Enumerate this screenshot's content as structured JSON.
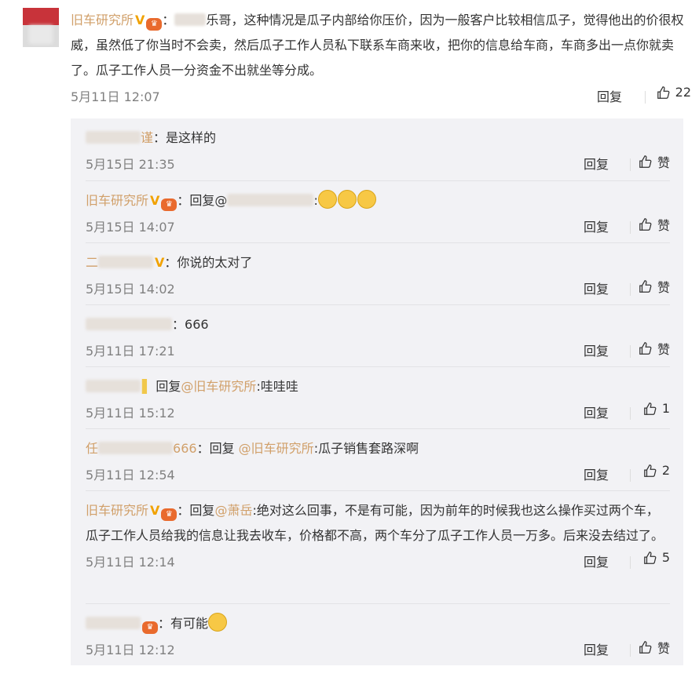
{
  "main_comment": {
    "author": "旧车研究所",
    "reply_to_suffix": "乐哥",
    "text": "，这种情况是瓜子内部给你压价，因为一般客户比较相信瓜子，觉得他出的价很权威，虽然低了你当时不会卖，然后瓜子工作人员私下联系车商来收，把你的信息给车商，车商多出一点你就卖了。瓜子工作人员一分资金不出就坐等分成。",
    "time": "5月11日 12:07",
    "reply_label": "回复",
    "likes": "22"
  },
  "replies": [
    {
      "author": "",
      "author_suffix": "谨",
      "text": "是这样的",
      "time": "5月15日 21:35",
      "reply_label": "回复",
      "likes": "赞"
    },
    {
      "author": "旧车研究所",
      "text": "回复@",
      "mention_suffix": "",
      "emoji_count": 3,
      "time": "5月15日 14:07",
      "reply_label": "回复",
      "likes": "赞"
    },
    {
      "author": "二",
      "text": "你说的太对了",
      "time": "5月15日 14:02",
      "reply_label": "回复",
      "likes": "赞"
    },
    {
      "author": "",
      "text": "666",
      "time": "5月11日 17:21",
      "reply_label": "回复",
      "likes": "赞"
    },
    {
      "author": "",
      "text": "回复",
      "mention": "@旧车研究所",
      "tail": ":哇哇哇",
      "time": "5月11日 15:12",
      "reply_label": "回复",
      "likes": "1"
    },
    {
      "author": "任",
      "author_suffix": "666",
      "text": "回复 ",
      "mention": "@旧车研究所",
      "tail": ":瓜子销售套路深啊",
      "time": "5月11日 12:54",
      "reply_label": "回复",
      "likes": "2"
    },
    {
      "author": "旧车研究所",
      "text": "回复",
      "mention": "@萧岳",
      "tail": ":绝对这么回事，不是有可能，因为前年的时候我也这么操作买过两个车，瓜子工作人员给我的信息让我去收车，价格都不高，两个车分了瓜子工作人员一万多。后来没去结过了。",
      "time": "5月11日 12:14",
      "reply_label": "回复",
      "likes": "5"
    },
    {
      "author": "",
      "text": "有可能",
      "time": "5月11日 12:12",
      "reply_label": "回复",
      "likes": "赞"
    }
  ],
  "icons": {
    "thumbs_up": "thumbs-up-icon"
  }
}
